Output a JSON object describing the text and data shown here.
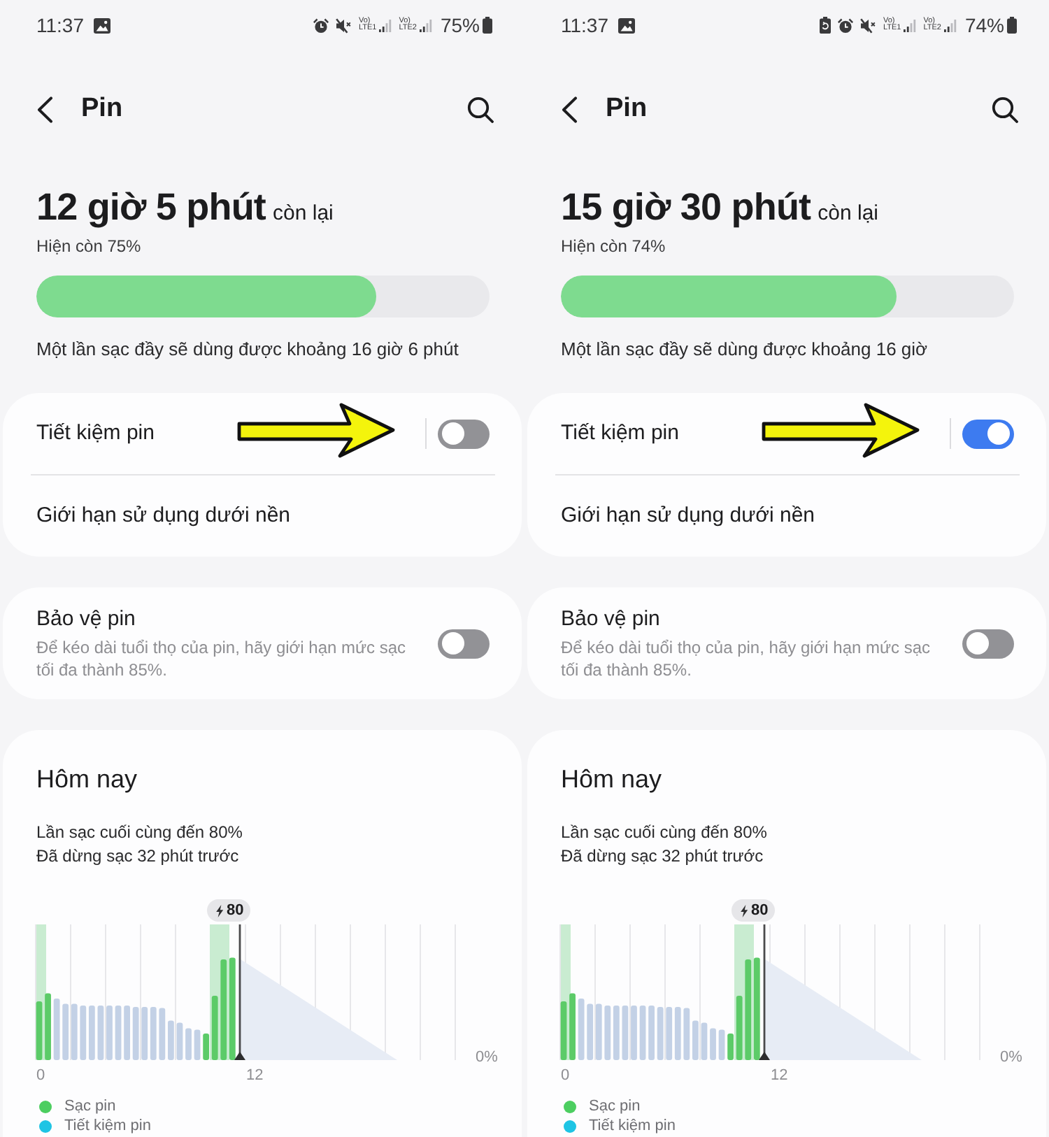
{
  "screens": [
    {
      "status_bar": {
        "time": "11:37",
        "notification_icons": [
          {
            "kind": "image"
          }
        ],
        "status_icons": [
          {
            "kind": "alarm"
          },
          {
            "kind": "muted"
          },
          {
            "kind": "sim",
            "top": "Vo)",
            "bottom": "LTE1"
          },
          {
            "kind": "sim",
            "top": "Vo)",
            "bottom": "LTE2"
          }
        ],
        "battery": "75%"
      },
      "header": {
        "title": "Pin"
      },
      "summary": {
        "remaining": "12 giờ 5 phút",
        "remaining_suffix": "còn lại",
        "current": "Hiện còn 75%",
        "level": 0.75,
        "full_charge_note": "Một lần sạc đầy sẽ dùng được khoảng 16 giờ 6 phút"
      },
      "settings_groups": [
        {
          "items": [
            {
              "kind": "split_toggle",
              "label": "Tiết kiệm pin",
              "on": false,
              "pointed_at": true
            },
            {
              "kind": "link",
              "label": "Giới hạn sử dụng dưới nền",
              "pointed_at": false
            }
          ]
        },
        {
          "items": [
            {
              "kind": "toggle",
              "label": "Bảo vệ pin",
              "description": "Để kéo dài tuổi thọ của pin, hãy giới hạn mức sạc tối đa thành 85%.",
              "on": false,
              "pointed_at": false
            }
          ]
        }
      ],
      "today": {
        "title": "Hôm nay",
        "last_charge": "Lần sạc cuối cùng đến 80%",
        "charge_stopped": "Đã dừng sạc 32 phút trước",
        "chart": {
          "charge_badge": "80",
          "y_label": "0%",
          "x_labels": [
            "0",
            "12"
          ]
        },
        "legend": [
          {
            "label": "Sạc pin",
            "color": "#4cce60"
          },
          {
            "label": "Tiết kiệm pin",
            "color": "#1ec4e4"
          }
        ]
      }
    },
    {
      "status_bar": {
        "time": "11:37",
        "notification_icons": [
          {
            "kind": "image"
          }
        ],
        "status_icons": [
          {
            "kind": "power_saving"
          },
          {
            "kind": "alarm"
          },
          {
            "kind": "muted"
          },
          {
            "kind": "sim",
            "top": "Vo)",
            "bottom": "LTE1"
          },
          {
            "kind": "sim",
            "top": "Vo)",
            "bottom": "LTE2"
          }
        ],
        "battery": "74%"
      },
      "header": {
        "title": "Pin"
      },
      "summary": {
        "remaining": "15 giờ 30 phút",
        "remaining_suffix": "còn lại",
        "current": "Hiện còn 74%",
        "level": 0.74,
        "full_charge_note": "Một lần sạc đầy sẽ dùng được khoảng 16 giờ"
      },
      "settings_groups": [
        {
          "items": [
            {
              "kind": "split_toggle",
              "label": "Tiết kiệm pin",
              "on": true,
              "pointed_at": true
            },
            {
              "kind": "link",
              "label": "Giới hạn sử dụng dưới nền",
              "pointed_at": false
            }
          ]
        },
        {
          "items": [
            {
              "kind": "toggle",
              "label": "Bảo vệ pin",
              "description": "Để kéo dài tuổi thọ của pin, hãy giới hạn mức sạc tối đa thành 85%.",
              "on": false,
              "pointed_at": false
            }
          ]
        }
      ],
      "today": {
        "title": "Hôm nay",
        "last_charge": "Lần sạc cuối cùng đến 80%",
        "charge_stopped": "Đã dừng sạc 32 phút trước",
        "chart": {
          "charge_badge": "80",
          "y_label": "0%",
          "x_labels": [
            "0",
            "12"
          ]
        },
        "legend": [
          {
            "label": "Sạc pin",
            "color": "#4cce60"
          },
          {
            "label": "Tiết kiệm pin",
            "color": "#1ec4e4"
          }
        ]
      }
    }
  ]
}
